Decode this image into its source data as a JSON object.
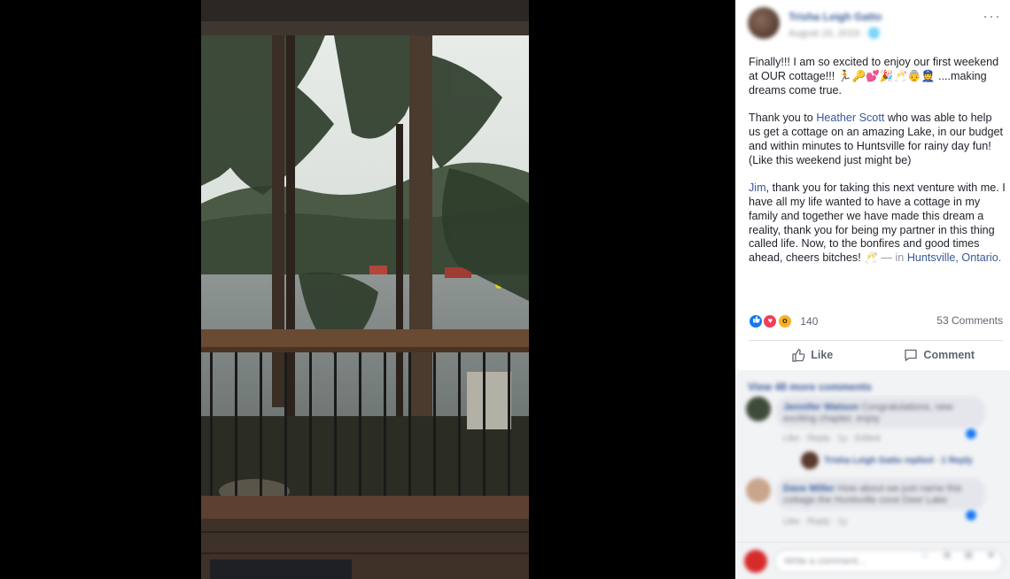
{
  "post": {
    "author": "Trisha Leigh Gatto",
    "meta": "August 16, 2019 · 🌐",
    "paragraph1": "Finally!!! I am so excited to enjoy our first weekend at OUR cottage!!! 🏃🔑💕🎉🥂👵👮 ....making dreams come true.",
    "p2_before": "Thank you to ",
    "p2_mention": "Heather Scott",
    "p2_after": " who was able to help us get a cottage on an amazing Lake, in our budget and within minutes to Huntsville for rainy day fun! (Like this weekend just might be)",
    "p3_mention": "Jim",
    "p3_text": ", thank you for taking this next venture with me. I have all my life wanted to have a cottage in my family and together we have made this dream a reality, thank you for being my partner in this thing called life. Now, to the bonfires and good times ahead, cheers bitches! 🥂 ",
    "p3_in": "— in ",
    "location": "Huntsville, Ontario."
  },
  "reactions": {
    "count": "140",
    "icons": [
      "like-icon",
      "love-icon",
      "wow-icon"
    ],
    "comments_label": "53 Comments"
  },
  "actions": {
    "like_label": "Like",
    "comment_label": "Comment"
  },
  "comments": {
    "view_more": "View 48 more comments",
    "c1_name": "Jennifer Watson",
    "c1_text": "Congratulations, new exciting chapter, enjoy",
    "c1_meta": "Like · Reply · 1y · Edited",
    "reply_name": "Trisha Leigh Gatto replied",
    "reply_count": "· 1 Reply",
    "c2_name": "Dave Miller",
    "c2_text": "How about we just name this cottage the Huntsville cove Deer Lake",
    "c2_meta": "Like · Reply · 1y",
    "composer_placeholder": "Write a comment...",
    "composer_icons": "☺ ◉ ▣ ☻"
  },
  "colors": {
    "link": "#385898",
    "like_blue": "#1877f2",
    "love_red": "#f33e58",
    "wow_yellow": "#f7b125"
  }
}
